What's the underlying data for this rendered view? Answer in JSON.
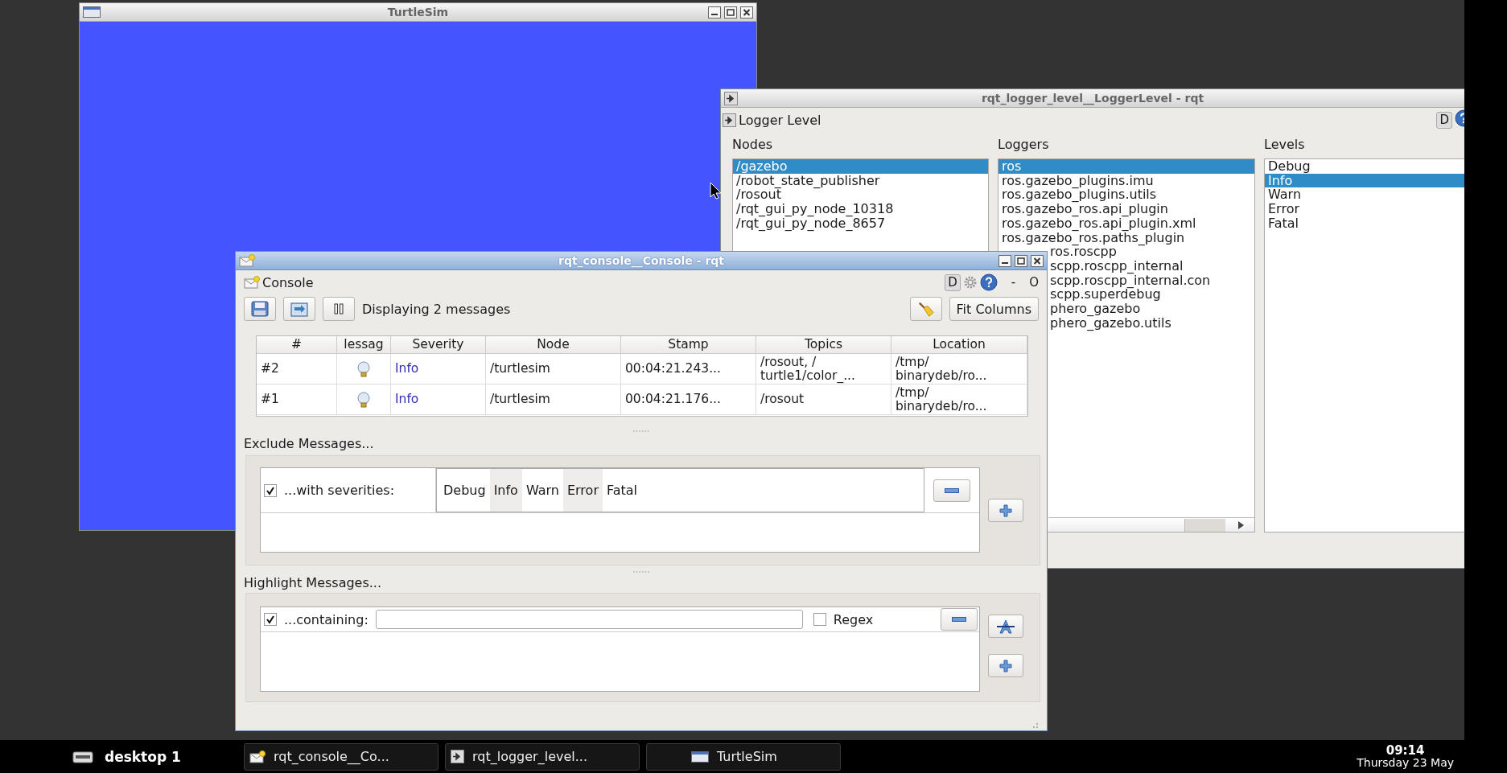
{
  "turtlesim": {
    "title": "TurtleSim"
  },
  "logger_window": {
    "title": "rqt_logger_level__LoggerLevel - rqt",
    "plugin_title": "Logger Level",
    "dock_button": "D",
    "nodes": {
      "label": "Nodes",
      "items": [
        {
          "text": "/gazebo",
          "selected": true
        },
        {
          "text": "/robot_state_publisher",
          "selected": false
        },
        {
          "text": "/rosout",
          "selected": false
        },
        {
          "text": "/rqt_gui_py_node_10318",
          "selected": false
        },
        {
          "text": "/rqt_gui_py_node_8657",
          "selected": false
        }
      ]
    },
    "loggers": {
      "label": "Loggers",
      "items": [
        {
          "text": "ros",
          "selected": true,
          "kind": "row"
        },
        {
          "text": "ros.gazebo_plugins.imu",
          "selected": false,
          "kind": "row"
        },
        {
          "text": "ros.gazebo_plugins.utils",
          "selected": false,
          "kind": "row"
        },
        {
          "text": "ros.gazebo_ros.api_plugin",
          "selected": false,
          "kind": "row"
        },
        {
          "text": "ros.gazebo_ros.api_plugin.xml",
          "selected": false,
          "kind": "row"
        },
        {
          "text": "ros.gazebo_ros.paths_plugin",
          "selected": false,
          "kind": "row"
        },
        {
          "text": "ros.roscpp",
          "selected": false,
          "kind": "covered"
        },
        {
          "text": "scpp.roscpp_internal",
          "selected": false,
          "kind": "covered"
        },
        {
          "text": "scpp.roscpp_internal.con",
          "selected": false,
          "kind": "covered"
        },
        {
          "text": "scpp.superdebug",
          "selected": false,
          "kind": "covered"
        },
        {
          "text": "phero_gazebo",
          "selected": false,
          "kind": "covered"
        },
        {
          "text": "phero_gazebo.utils",
          "selected": false,
          "kind": "covered"
        }
      ]
    },
    "levels": {
      "label": "Levels",
      "items": [
        {
          "text": "Debug",
          "selected": false
        },
        {
          "text": "Info",
          "selected": true
        },
        {
          "text": "Warn",
          "selected": false
        },
        {
          "text": "Error",
          "selected": false
        },
        {
          "text": "Fatal",
          "selected": false
        }
      ]
    }
  },
  "console_window": {
    "title": "rqt_console__Console - rqt",
    "plugin_title": "Console",
    "dock_button": "D",
    "dock_controls": [
      "-",
      "O"
    ],
    "status": "Displaying 2 messages",
    "fit_button": "Fit Columns",
    "table": {
      "columns": [
        "#",
        "lessag",
        "Severity",
        "Node",
        "Stamp",
        "Topics",
        "Location"
      ],
      "rows": [
        {
          "number": "#2",
          "severity": "Info",
          "node": "/turtlesim",
          "stamp": "00:04:21.243...",
          "topics": "/rosout, /\nturtle1/color_...",
          "location": "/tmp/\nbinarydeb/ro..."
        },
        {
          "number": "#1",
          "severity": "Info",
          "node": "/turtlesim",
          "stamp": "00:04:21.176...",
          "topics": "/rosout",
          "location": "/tmp/\nbinarydeb/ro..."
        }
      ]
    },
    "exclude": {
      "label": "Exclude Messages...",
      "filters": [
        {
          "checked": true,
          "label": "...with severities:",
          "severities": [
            {
              "text": "Debug",
              "selected": false
            },
            {
              "text": "Info",
              "selected": true
            },
            {
              "text": "Warn",
              "selected": false
            },
            {
              "text": "Error",
              "selected": true
            },
            {
              "text": "Fatal",
              "selected": false
            }
          ]
        }
      ]
    },
    "highlight": {
      "label": "Highlight Messages...",
      "filters": [
        {
          "checked": true,
          "label": "...containing:",
          "regex": {
            "label": "Regex",
            "checked": false
          }
        }
      ]
    }
  },
  "taskbar": {
    "desktop": "desktop 1",
    "tasks": [
      {
        "text": "rqt_console__Co...",
        "kind": "console"
      },
      {
        "text": "rqt_logger_level...",
        "kind": "logger"
      },
      {
        "text": "TurtleSim",
        "kind": "window"
      }
    ],
    "clock": {
      "time": "09:14",
      "date": "Thursday 23 May"
    }
  }
}
